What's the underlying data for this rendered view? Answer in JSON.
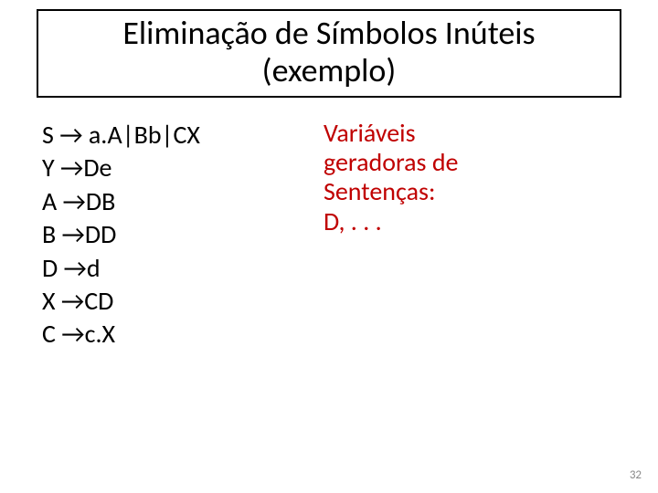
{
  "title_line1": "Eliminação de Símbolos Inúteis",
  "title_line2": "(exemplo)",
  "grammar": {
    "r1": "S → a.A|Bb|CX",
    "r2": "Y →De",
    "r3": "A →DB",
    "r4": "B →DD",
    "r5": "D →d",
    "r6": "X →CD",
    "r7": "C →c.X"
  },
  "note": {
    "l1": "Variáveis",
    "l2": "geradoras de",
    "l3": "Sentenças:",
    "l4": "D, . . ."
  },
  "page": "32"
}
